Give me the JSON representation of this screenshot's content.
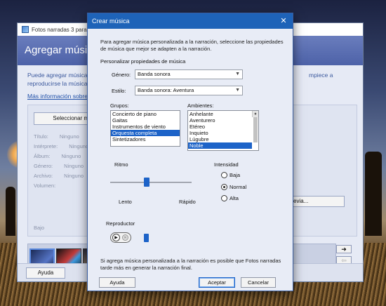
{
  "background_app": {
    "window_title": "Fotos narradas 3 para W",
    "header_title": "Agregar música",
    "description_left": "Puede agregar música a",
    "description_left_2": "reproducirse la música",
    "description_right": "mpiece a",
    "link": "Más información sobre",
    "select_button": "Seleccionar mú",
    "properties": [
      {
        "label": "Título:",
        "value": "Ninguno"
      },
      {
        "label": "Intérprete:",
        "value": "Ninguno"
      },
      {
        "label": "Álbum:",
        "value": "Ninguno"
      },
      {
        "label": "Género:",
        "value": "Ninguno"
      },
      {
        "label": "Archivo:",
        "value": "Ninguno"
      },
      {
        "label": "Volumen:",
        "value": ""
      }
    ],
    "low_label": "Bajo",
    "preview_button": "evia...",
    "help_button": "Ayuda",
    "filmstrip_arrows": [
      "➜",
      "⇦",
      "✕"
    ]
  },
  "dialog": {
    "title": "Crear música",
    "close_glyph": "✕",
    "intro": "Para agregar música personalizada a la narración, seleccione las propiedades de música que mejor se adapten a la narración.",
    "section_label": "Personalizar propiedades de música",
    "genre_label": "Género:",
    "genre_value": "Banda sonora",
    "style_label": "Estilo:",
    "style_value": "Banda sonora: Aventura",
    "groups_label": "Grupos:",
    "groups": [
      "Concierto de piano",
      "Gaitas",
      "Instrumentos de viento",
      "Orquesta completa",
      "Sintetizadores"
    ],
    "groups_selected": 3,
    "ambients_label": "Ambientes:",
    "ambients": [
      "Anhelante",
      "Aventurero",
      "Etéreo",
      "Inquieto",
      "Lúgubre",
      "Noble"
    ],
    "ambients_selected": 5,
    "rhythm_label": "Ritmo",
    "rhythm_slow": "Lento",
    "rhythm_fast": "Rápido",
    "rhythm_level": 0.45,
    "intensity_label": "Intensidad",
    "intensity_options": [
      "Baja",
      "Normal",
      "Alta"
    ],
    "intensity_selected": "Normal",
    "player_label": "Reproductor",
    "play_glyph": "▶",
    "stop_glyph": "✕",
    "note": "Si agrega música personalizada a la narración es posible que Fotos narradas tarde más en generar la narración final.",
    "help_button": "Ayuda",
    "accept_button": "Aceptar",
    "cancel_button": "Cancelar"
  }
}
